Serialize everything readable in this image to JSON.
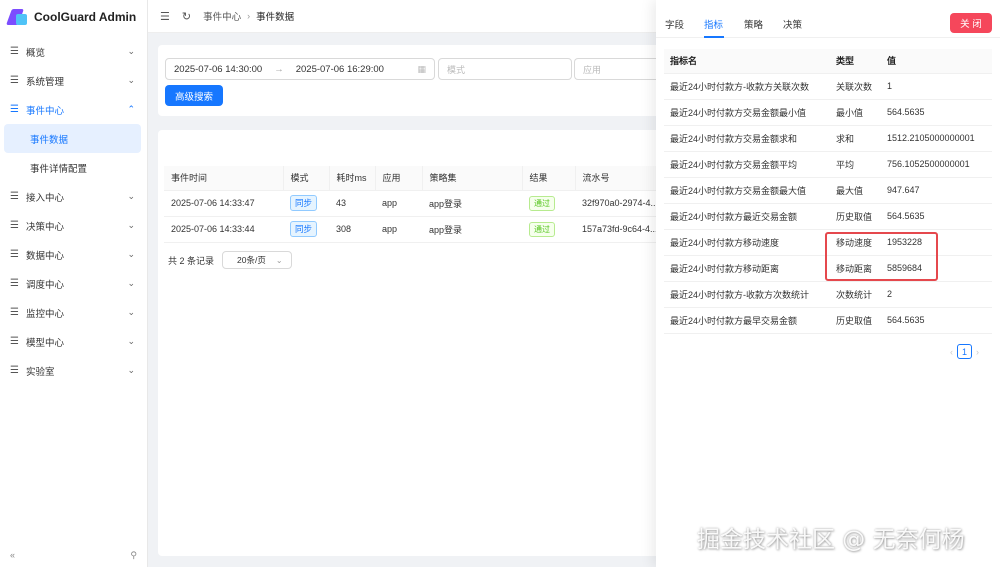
{
  "app": {
    "title": "CoolGuard Admin"
  },
  "sidebar": {
    "items": [
      {
        "label": "概览",
        "icon": "menu-lines-icon",
        "arrow": "⌄"
      },
      {
        "label": "系统管理",
        "icon": "menu-lines-icon",
        "arrow": "⌄"
      },
      {
        "label": "事件中心",
        "icon": "menu-lines-icon",
        "arrow": "⌃",
        "open": true
      },
      {
        "label": "接入中心",
        "icon": "menu-lines-icon",
        "arrow": "⌄"
      },
      {
        "label": "决策中心",
        "icon": "menu-lines-icon",
        "arrow": "⌄"
      },
      {
        "label": "数据中心",
        "icon": "menu-lines-icon",
        "arrow": "⌄"
      },
      {
        "label": "调度中心",
        "icon": "menu-lines-icon",
        "arrow": "⌄"
      },
      {
        "label": "监控中心",
        "icon": "menu-lines-icon",
        "arrow": "⌄"
      },
      {
        "label": "模型中心",
        "icon": "menu-lines-icon",
        "arrow": "⌄"
      },
      {
        "label": "实验室",
        "icon": "menu-lines-icon",
        "arrow": "⌄"
      }
    ],
    "sub_items": [
      {
        "label": "事件数据",
        "active": true
      },
      {
        "label": "事件详情配置"
      }
    ],
    "collapse_icon": "«",
    "pin_icon": "⚲"
  },
  "header": {
    "breadcrumb": [
      "事件中心",
      "事件数据"
    ]
  },
  "search": {
    "start_time": "2025-07-06 14:30:00",
    "end_time": "2025-07-06 16:29:00",
    "mode_placeholder": "模式",
    "app_placeholder": "应用",
    "advanced_label": "高级搜索"
  },
  "events_table": {
    "columns": [
      "事件时间",
      "模式",
      "耗时ms",
      "应用",
      "策略集",
      "结果",
      "流水号"
    ],
    "rows": [
      {
        "time": "2025-07-06 14:33:47",
        "mode": "同步",
        "cost": "43",
        "app": "app",
        "policy": "app登录",
        "result": "通过",
        "serial": "32f970a0-2974-4..."
      },
      {
        "time": "2025-07-06 14:33:44",
        "mode": "同步",
        "cost": "308",
        "app": "app",
        "policy": "app登录",
        "result": "通过",
        "serial": "157a73fd-9c64-4..."
      }
    ],
    "total_text": "共 2 条记录",
    "page_size": "20条/页"
  },
  "drawer": {
    "tabs": [
      "字段",
      "指标",
      "策略",
      "决策"
    ],
    "active_tab": 1,
    "close_label": "关 闭",
    "metrics_columns": [
      "指标名",
      "类型",
      "值"
    ],
    "metrics": [
      {
        "name": "最近24小时付款方-收款方关联次数",
        "type": "关联次数",
        "value": "1"
      },
      {
        "name": "最近24小时付款方交易金额最小值",
        "type": "最小值",
        "value": "564.5635"
      },
      {
        "name": "最近24小时付款方交易金额求和",
        "type": "求和",
        "value": "1512.2105000000001"
      },
      {
        "name": "最近24小时付款方交易金额平均",
        "type": "平均",
        "value": "756.1052500000001"
      },
      {
        "name": "最近24小时付款方交易金额最大值",
        "type": "最大值",
        "value": "947.647"
      },
      {
        "name": "最近24小时付款方最近交易金额",
        "type": "历史取值",
        "value": "564.5635"
      },
      {
        "name": "最近24小时付款方移动速度",
        "type": "移动速度",
        "value": "1953228"
      },
      {
        "name": "最近24小时付款方移动距离",
        "type": "移动距离",
        "value": "5859684"
      },
      {
        "name": "最近24小时付款方-收款方次数统计",
        "type": "次数统计",
        "value": "2"
      },
      {
        "name": "最近24小时付款方最早交易金额",
        "type": "历史取值",
        "value": "564.5635"
      }
    ],
    "current_page": "1"
  },
  "watermark": "掘金技术社区 @ 无奈何杨",
  "colors": {
    "primary": "#1677ff",
    "danger": "#f5475b",
    "highlight": "#e5484d"
  }
}
